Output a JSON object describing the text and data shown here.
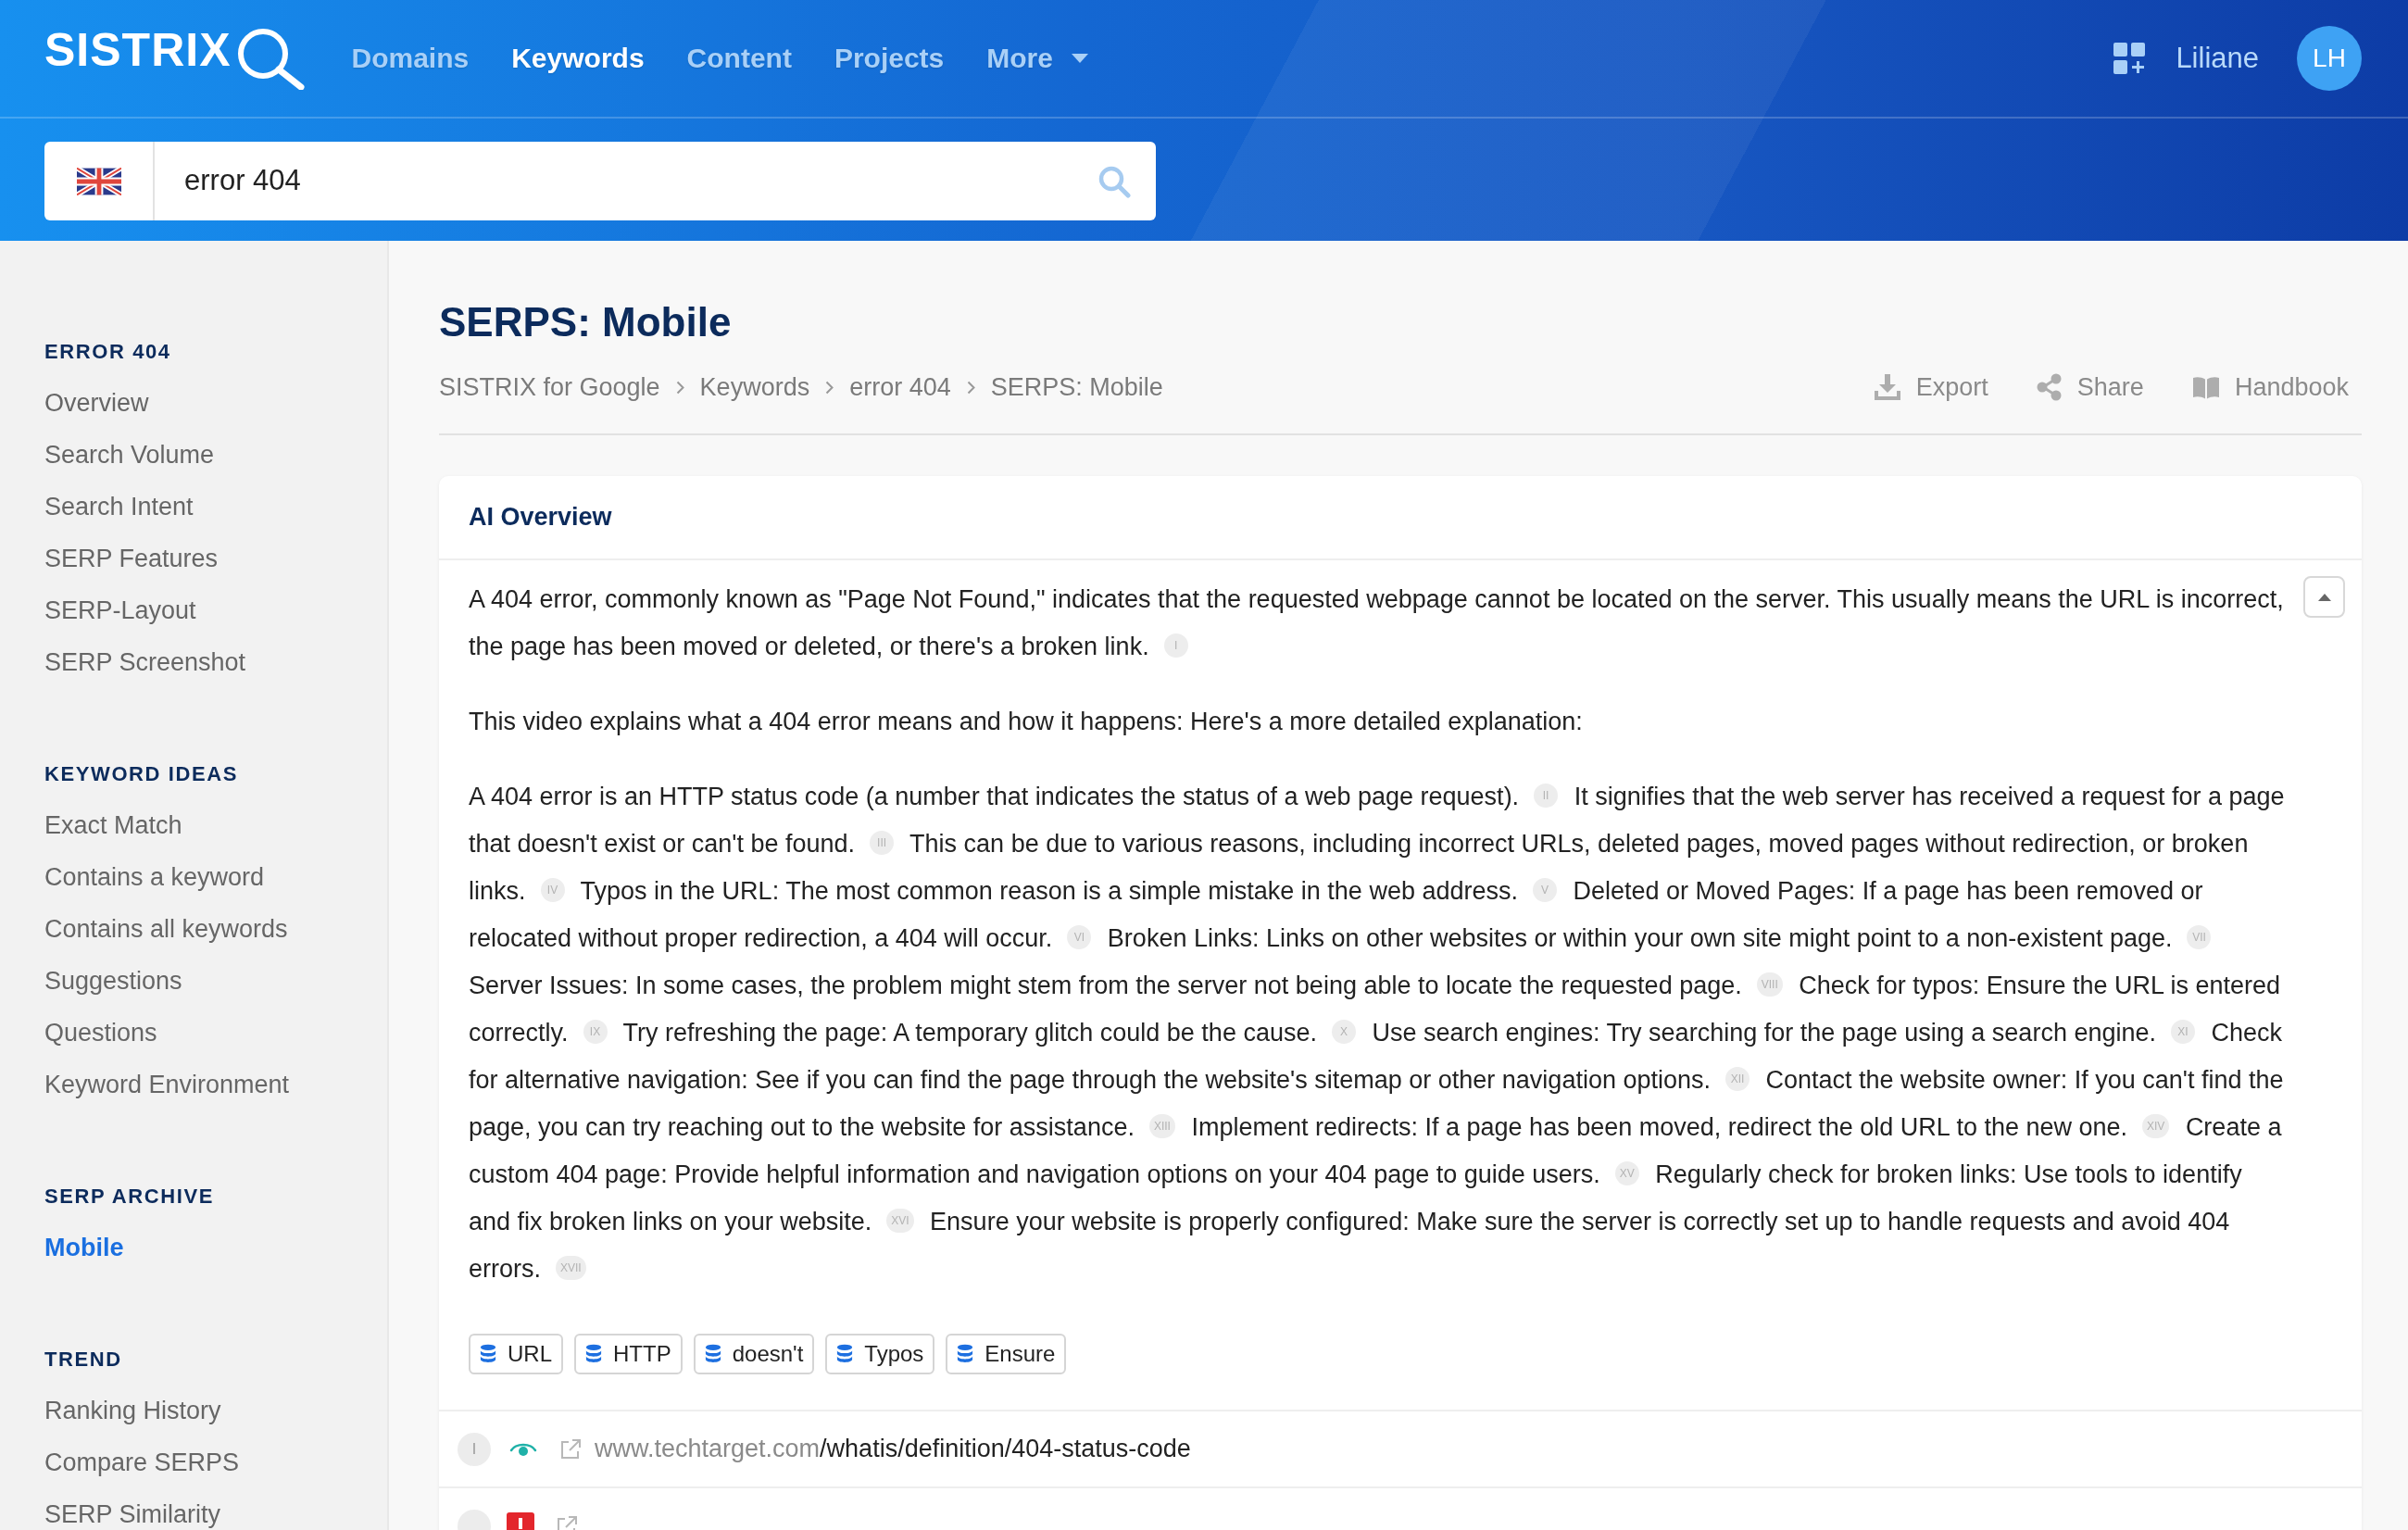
{
  "header": {
    "logo": "SISTRIX",
    "nav": [
      {
        "label": "Domains",
        "selected": false,
        "kind": "link"
      },
      {
        "label": "Keywords",
        "selected": true,
        "kind": "link"
      },
      {
        "label": "Content",
        "selected": false,
        "kind": "link"
      },
      {
        "label": "Projects",
        "selected": false,
        "kind": "link"
      },
      {
        "label": "More",
        "selected": false,
        "kind": "dropdown"
      }
    ],
    "user_name": "Liliane",
    "avatar_initials": "LH"
  },
  "search": {
    "value": "error 404"
  },
  "sidebar": {
    "sections": [
      {
        "title": "ERROR 404",
        "items": [
          {
            "label": "Overview",
            "selected": false
          },
          {
            "label": "Search Volume",
            "selected": false
          },
          {
            "label": "Search Intent",
            "selected": false
          },
          {
            "label": "SERP Features",
            "selected": false
          },
          {
            "label": "SERP-Layout",
            "selected": false
          },
          {
            "label": "SERP Screenshot",
            "selected": false
          }
        ]
      },
      {
        "title": "KEYWORD IDEAS",
        "items": [
          {
            "label": "Exact Match",
            "selected": false
          },
          {
            "label": "Contains a keyword",
            "selected": false
          },
          {
            "label": "Contains all keywords",
            "selected": false
          },
          {
            "label": "Suggestions",
            "selected": false
          },
          {
            "label": "Questions",
            "selected": false
          },
          {
            "label": "Keyword Environment",
            "selected": false
          }
        ]
      },
      {
        "title": "SERP ARCHIVE",
        "items": [
          {
            "label": "Mobile",
            "selected": true
          }
        ]
      },
      {
        "title": "TREND",
        "items": [
          {
            "label": "Ranking History",
            "selected": false
          },
          {
            "label": "Compare SERPS",
            "selected": false
          },
          {
            "label": "SERP Similarity",
            "selected": false
          }
        ]
      }
    ]
  },
  "page": {
    "title": "SERPS: Mobile",
    "breadcrumb": [
      "SISTRIX for Google",
      "Keywords",
      "error 404",
      "SERPS: Mobile"
    ],
    "actions": [
      {
        "label": "Export",
        "kind": "export"
      },
      {
        "label": "Share",
        "kind": "share"
      },
      {
        "label": "Handbook",
        "kind": "handbook"
      }
    ]
  },
  "ai_overview": {
    "title": "AI Overview",
    "expanded": true,
    "paragraphs": [
      {
        "sentences": [
          {
            "text": "A 404 error, commonly known as \"Page Not Found,\" indicates that the requested webpage cannot be located on the server. This usually means the URL is incorrect, the page has been moved or deleted, or there's a broken link.",
            "citation": "I"
          }
        ]
      },
      {
        "sentences": [
          {
            "text": "This video explains what a 404 error means and how it happens: Here's a more detailed explanation:"
          }
        ]
      },
      {
        "sentences": [
          {
            "text": "A 404 error is an HTTP status code (a number that indicates the status of a web page request).",
            "citation": "II"
          },
          {
            "text": "It signifies that the web server has received a request for a page that doesn't exist or can't be found.",
            "citation": "III"
          },
          {
            "text": "This can be due to various reasons, including incorrect URLs, deleted pages, moved pages without redirection, or broken links.",
            "citation": "IV"
          },
          {
            "text": "Typos in the URL: The most common reason is a simple mistake in the web address.",
            "citation": "V"
          },
          {
            "text": "Deleted or Moved Pages: If a page has been removed or relocated without proper redirection, a 404 will occur.",
            "citation": "VI"
          },
          {
            "text": "Broken Links: Links on other websites or within your own site might point to a non-existent page.",
            "citation": "VII"
          },
          {
            "text": "Server Issues: In some cases, the problem might stem from the server not being able to locate the requested page.",
            "citation": "VIII"
          },
          {
            "text": "Check for typos: Ensure the URL is entered correctly.",
            "citation": "IX"
          },
          {
            "text": "Try refreshing the page: A temporary glitch could be the cause.",
            "citation": "X"
          },
          {
            "text": "Use search engines: Try searching for the page using a search engine.",
            "citation": "XI"
          },
          {
            "text": "Check for alternative navigation: See if you can find the page through the website's sitemap or other navigation options.",
            "citation": "XII"
          },
          {
            "text": "Contact the website owner: If you can't find the page, you can try reaching out to the website for assistance.",
            "citation": "XIII"
          },
          {
            "text": "Implement redirects: If a page has been moved, redirect the old URL to the new one.",
            "citation": "XIV"
          },
          {
            "text": "Create a custom 404 page: Provide helpful information and navigation options on your 404 page to guide users.",
            "citation": "XV"
          },
          {
            "text": "Regularly check for broken links: Use tools to identify and fix broken links on your website.",
            "citation": "XVI"
          },
          {
            "text": "Ensure your website is properly configured: Make sure the server is correctly set up to handle requests and avoid 404 errors.",
            "citation": "XVII"
          }
        ]
      }
    ],
    "tags": [
      "URL",
      "HTTP",
      "doesn't",
      "Typos",
      "Ensure"
    ]
  },
  "results": [
    {
      "kind": "organic",
      "rank": "I",
      "domain": "www.techtarget.com",
      "path": "/whatis/definition/404-status-code"
    },
    {
      "kind": "feature"
    }
  ]
}
